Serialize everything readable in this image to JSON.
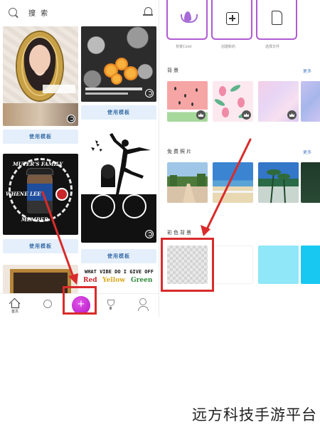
{
  "left_screen": {
    "search_label": "搜 索",
    "cards": [
      {
        "button_label": "使用模板"
      },
      {
        "button_label": "使用模板"
      },
      {
        "button_label": "使用模板",
        "text_top": "MUTER'S FAMILY",
        "text_mid": "WHENE LEE",
        "text_bottom": "MEMBER"
      },
      {
        "button_label": "使用模板"
      }
    ],
    "text_art": {
      "line1": "WHAT VIBE DO I GIVE OFF",
      "word1": "Red",
      "word2": "Yellow",
      "word3": "Green"
    },
    "nav": {
      "home_label": "首页"
    }
  },
  "right_screen": {
    "tools": [
      {
        "label": "背景Color",
        "icon": "lotus-icon"
      },
      {
        "label": "创建新的",
        "icon": "plus-box-icon"
      },
      {
        "label": "选择文件",
        "icon": "file-icon"
      }
    ],
    "sections": {
      "backgrounds": {
        "title": "背景",
        "more": "更多"
      },
      "free_photos": {
        "title": "免费照片",
        "more": "更多"
      },
      "color_backgrounds": {
        "title": "彩色背景"
      }
    }
  },
  "colors": {
    "accent": "#b05bd2",
    "annotation": "#d92b2b",
    "nav_plus": "#c22ad4",
    "button_bg": "#e4effb",
    "link": "#4a7ec4"
  },
  "watermark": "远方科技手游平台"
}
